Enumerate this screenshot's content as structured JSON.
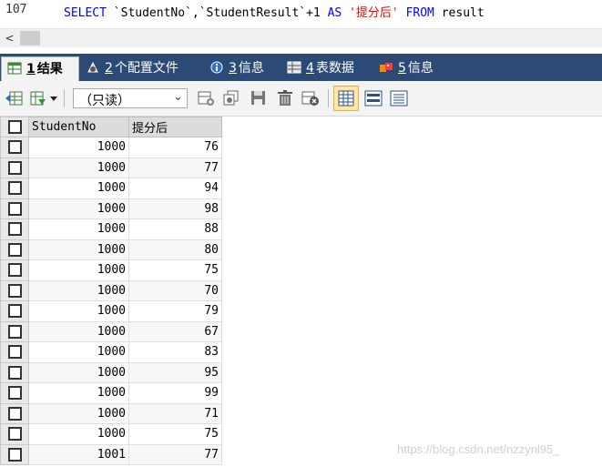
{
  "editor": {
    "line_number": "107",
    "sql": {
      "select_kw": "SELECT",
      "col1": "`StudentNo`",
      "comma": ",",
      "col2": "`StudentResult`+1",
      "as_kw": "AS",
      "alias": "'提分后'",
      "from_kw": "FROM",
      "table": "result"
    },
    "scroll_left_glyph": "<"
  },
  "tabs": [
    {
      "number": "1",
      "label": "结果",
      "icon": "result-grid-icon",
      "active": true
    },
    {
      "number": "2",
      "label": "个配置文件",
      "icon": "profile-icon",
      "active": false
    },
    {
      "number": "3",
      "label": "信息",
      "icon": "info-icon",
      "active": false
    },
    {
      "number": "4",
      "label": "表数据",
      "icon": "table-data-icon",
      "active": false
    },
    {
      "number": "5",
      "label": "信息",
      "icon": "info-history-icon",
      "active": false
    }
  ],
  "toolbar": {
    "mode_select": "（只读）",
    "icons": [
      "export-grid-icon",
      "import-grid-icon",
      "add-row-icon",
      "duplicate-row-icon",
      "save-icon",
      "delete-icon",
      "cancel-icon",
      "grid-view-icon",
      "form-view-icon",
      "text-view-icon"
    ]
  },
  "grid": {
    "columns": [
      "StudentNo",
      "提分后"
    ],
    "rows": [
      [
        "1000",
        "76"
      ],
      [
        "1000",
        "77"
      ],
      [
        "1000",
        "94"
      ],
      [
        "1000",
        "98"
      ],
      [
        "1000",
        "88"
      ],
      [
        "1000",
        "80"
      ],
      [
        "1000",
        "75"
      ],
      [
        "1000",
        "70"
      ],
      [
        "1000",
        "79"
      ],
      [
        "1000",
        "67"
      ],
      [
        "1000",
        "83"
      ],
      [
        "1000",
        "95"
      ],
      [
        "1000",
        "99"
      ],
      [
        "1000",
        "71"
      ],
      [
        "1000",
        "75"
      ],
      [
        "1001",
        "77"
      ]
    ]
  },
  "watermark": "https://blog.csdn.net/nzzynl95_"
}
